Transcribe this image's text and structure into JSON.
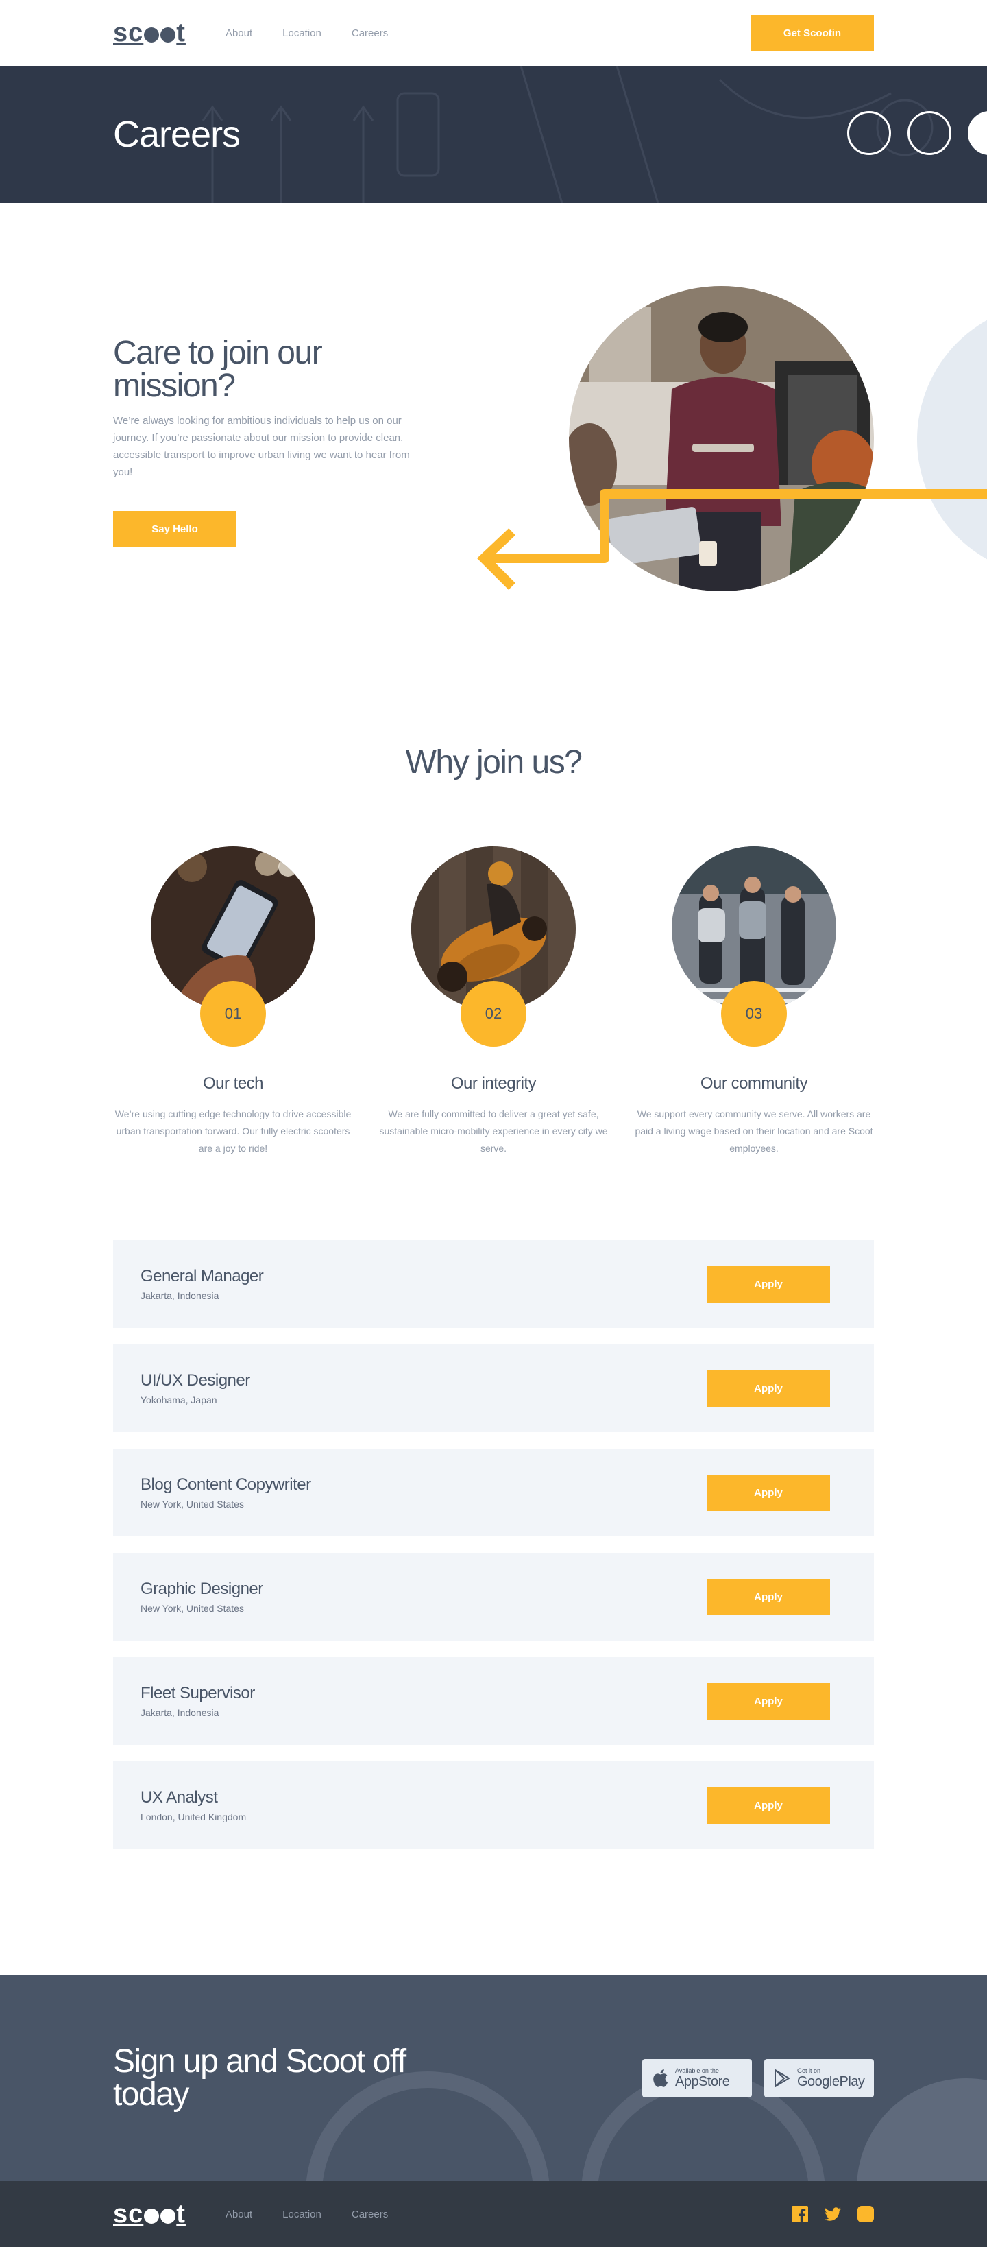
{
  "brand": {
    "logo_pre": "sc",
    "logo_post": "t"
  },
  "nav": [
    {
      "label": "About"
    },
    {
      "label": "Location"
    },
    {
      "label": "Careers"
    }
  ],
  "header": {
    "cta_label": "Get Scootin"
  },
  "banner": {
    "title": "Careers"
  },
  "intro": {
    "heading": "Care to join our mission?",
    "body": "We’re always looking for ambitious individuals to help us on our journey. If you’re passionate about our mission to provide clean, accessible transport to improve urban living we want to hear from you!",
    "cta_label": "Say Hello"
  },
  "why": {
    "heading": "Why join us?",
    "features": [
      {
        "number": "01",
        "title": "Our tech",
        "body": "We’re using cutting edge technology to drive accessible urban transportation forward. Our fully electric scooters are a joy to ride!"
      },
      {
        "number": "02",
        "title": "Our integrity",
        "body": "We are fully committed to deliver a great yet safe, sustainable micro-mobility experience in every city we serve."
      },
      {
        "number": "03",
        "title": "Our community",
        "body": "We support every community we serve. All workers are paid a living wage based on their location and are Scoot employees."
      }
    ]
  },
  "jobs": {
    "apply_label": "Apply",
    "items": [
      {
        "title": "General Manager",
        "location": "Jakarta, Indonesia"
      },
      {
        "title": "UI/UX Designer",
        "location": "Yokohama, Japan"
      },
      {
        "title": "Blog Content Copywriter",
        "location": "New York, United States"
      },
      {
        "title": "Graphic Designer",
        "location": "New York, United States"
      },
      {
        "title": "Fleet Supervisor",
        "location": "Jakarta, Indonesia"
      },
      {
        "title": "UX Analyst",
        "location": "London, United Kingdom"
      }
    ]
  },
  "signup": {
    "heading": "Sign up and Scoot off today",
    "appstore": {
      "small": "Available on the",
      "big": "AppStore",
      "icon": "apple-icon"
    },
    "googleplay": {
      "small": "Get it on",
      "big": "GooglePlay",
      "icon": "play-icon"
    }
  },
  "footer": {
    "socials": [
      {
        "icon": "facebook-icon"
      },
      {
        "icon": "twitter-icon"
      },
      {
        "icon": "instagram-icon"
      }
    ]
  },
  "colors": {
    "accent": "#fcb72b",
    "dark": "#495567",
    "darker": "#333a44",
    "light": "#e5ebf2",
    "muted": "#939caa"
  }
}
